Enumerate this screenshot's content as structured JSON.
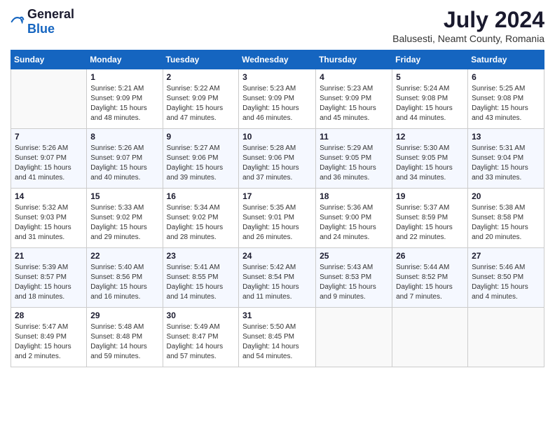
{
  "header": {
    "logo_general": "General",
    "logo_blue": "Blue",
    "month_year": "July 2024",
    "location": "Balusesti, Neamt County, Romania"
  },
  "calendar": {
    "days_of_week": [
      "Sunday",
      "Monday",
      "Tuesday",
      "Wednesday",
      "Thursday",
      "Friday",
      "Saturday"
    ],
    "weeks": [
      [
        {
          "day": "",
          "sunrise": "",
          "sunset": "",
          "daylight": ""
        },
        {
          "day": "1",
          "sunrise": "Sunrise: 5:21 AM",
          "sunset": "Sunset: 9:09 PM",
          "daylight": "Daylight: 15 hours and 48 minutes."
        },
        {
          "day": "2",
          "sunrise": "Sunrise: 5:22 AM",
          "sunset": "Sunset: 9:09 PM",
          "daylight": "Daylight: 15 hours and 47 minutes."
        },
        {
          "day": "3",
          "sunrise": "Sunrise: 5:23 AM",
          "sunset": "Sunset: 9:09 PM",
          "daylight": "Daylight: 15 hours and 46 minutes."
        },
        {
          "day": "4",
          "sunrise": "Sunrise: 5:23 AM",
          "sunset": "Sunset: 9:09 PM",
          "daylight": "Daylight: 15 hours and 45 minutes."
        },
        {
          "day": "5",
          "sunrise": "Sunrise: 5:24 AM",
          "sunset": "Sunset: 9:08 PM",
          "daylight": "Daylight: 15 hours and 44 minutes."
        },
        {
          "day": "6",
          "sunrise": "Sunrise: 5:25 AM",
          "sunset": "Sunset: 9:08 PM",
          "daylight": "Daylight: 15 hours and 43 minutes."
        }
      ],
      [
        {
          "day": "7",
          "sunrise": "Sunrise: 5:26 AM",
          "sunset": "Sunset: 9:07 PM",
          "daylight": "Daylight: 15 hours and 41 minutes."
        },
        {
          "day": "8",
          "sunrise": "Sunrise: 5:26 AM",
          "sunset": "Sunset: 9:07 PM",
          "daylight": "Daylight: 15 hours and 40 minutes."
        },
        {
          "day": "9",
          "sunrise": "Sunrise: 5:27 AM",
          "sunset": "Sunset: 9:06 PM",
          "daylight": "Daylight: 15 hours and 39 minutes."
        },
        {
          "day": "10",
          "sunrise": "Sunrise: 5:28 AM",
          "sunset": "Sunset: 9:06 PM",
          "daylight": "Daylight: 15 hours and 37 minutes."
        },
        {
          "day": "11",
          "sunrise": "Sunrise: 5:29 AM",
          "sunset": "Sunset: 9:05 PM",
          "daylight": "Daylight: 15 hours and 36 minutes."
        },
        {
          "day": "12",
          "sunrise": "Sunrise: 5:30 AM",
          "sunset": "Sunset: 9:05 PM",
          "daylight": "Daylight: 15 hours and 34 minutes."
        },
        {
          "day": "13",
          "sunrise": "Sunrise: 5:31 AM",
          "sunset": "Sunset: 9:04 PM",
          "daylight": "Daylight: 15 hours and 33 minutes."
        }
      ],
      [
        {
          "day": "14",
          "sunrise": "Sunrise: 5:32 AM",
          "sunset": "Sunset: 9:03 PM",
          "daylight": "Daylight: 15 hours and 31 minutes."
        },
        {
          "day": "15",
          "sunrise": "Sunrise: 5:33 AM",
          "sunset": "Sunset: 9:02 PM",
          "daylight": "Daylight: 15 hours and 29 minutes."
        },
        {
          "day": "16",
          "sunrise": "Sunrise: 5:34 AM",
          "sunset": "Sunset: 9:02 PM",
          "daylight": "Daylight: 15 hours and 28 minutes."
        },
        {
          "day": "17",
          "sunrise": "Sunrise: 5:35 AM",
          "sunset": "Sunset: 9:01 PM",
          "daylight": "Daylight: 15 hours and 26 minutes."
        },
        {
          "day": "18",
          "sunrise": "Sunrise: 5:36 AM",
          "sunset": "Sunset: 9:00 PM",
          "daylight": "Daylight: 15 hours and 24 minutes."
        },
        {
          "day": "19",
          "sunrise": "Sunrise: 5:37 AM",
          "sunset": "Sunset: 8:59 PM",
          "daylight": "Daylight: 15 hours and 22 minutes."
        },
        {
          "day": "20",
          "sunrise": "Sunrise: 5:38 AM",
          "sunset": "Sunset: 8:58 PM",
          "daylight": "Daylight: 15 hours and 20 minutes."
        }
      ],
      [
        {
          "day": "21",
          "sunrise": "Sunrise: 5:39 AM",
          "sunset": "Sunset: 8:57 PM",
          "daylight": "Daylight: 15 hours and 18 minutes."
        },
        {
          "day": "22",
          "sunrise": "Sunrise: 5:40 AM",
          "sunset": "Sunset: 8:56 PM",
          "daylight": "Daylight: 15 hours and 16 minutes."
        },
        {
          "day": "23",
          "sunrise": "Sunrise: 5:41 AM",
          "sunset": "Sunset: 8:55 PM",
          "daylight": "Daylight: 15 hours and 14 minutes."
        },
        {
          "day": "24",
          "sunrise": "Sunrise: 5:42 AM",
          "sunset": "Sunset: 8:54 PM",
          "daylight": "Daylight: 15 hours and 11 minutes."
        },
        {
          "day": "25",
          "sunrise": "Sunrise: 5:43 AM",
          "sunset": "Sunset: 8:53 PM",
          "daylight": "Daylight: 15 hours and 9 minutes."
        },
        {
          "day": "26",
          "sunrise": "Sunrise: 5:44 AM",
          "sunset": "Sunset: 8:52 PM",
          "daylight": "Daylight: 15 hours and 7 minutes."
        },
        {
          "day": "27",
          "sunrise": "Sunrise: 5:46 AM",
          "sunset": "Sunset: 8:50 PM",
          "daylight": "Daylight: 15 hours and 4 minutes."
        }
      ],
      [
        {
          "day": "28",
          "sunrise": "Sunrise: 5:47 AM",
          "sunset": "Sunset: 8:49 PM",
          "daylight": "Daylight: 15 hours and 2 minutes."
        },
        {
          "day": "29",
          "sunrise": "Sunrise: 5:48 AM",
          "sunset": "Sunset: 8:48 PM",
          "daylight": "Daylight: 14 hours and 59 minutes."
        },
        {
          "day": "30",
          "sunrise": "Sunrise: 5:49 AM",
          "sunset": "Sunset: 8:47 PM",
          "daylight": "Daylight: 14 hours and 57 minutes."
        },
        {
          "day": "31",
          "sunrise": "Sunrise: 5:50 AM",
          "sunset": "Sunset: 8:45 PM",
          "daylight": "Daylight: 14 hours and 54 minutes."
        },
        {
          "day": "",
          "sunrise": "",
          "sunset": "",
          "daylight": ""
        },
        {
          "day": "",
          "sunrise": "",
          "sunset": "",
          "daylight": ""
        },
        {
          "day": "",
          "sunrise": "",
          "sunset": "",
          "daylight": ""
        }
      ]
    ]
  }
}
